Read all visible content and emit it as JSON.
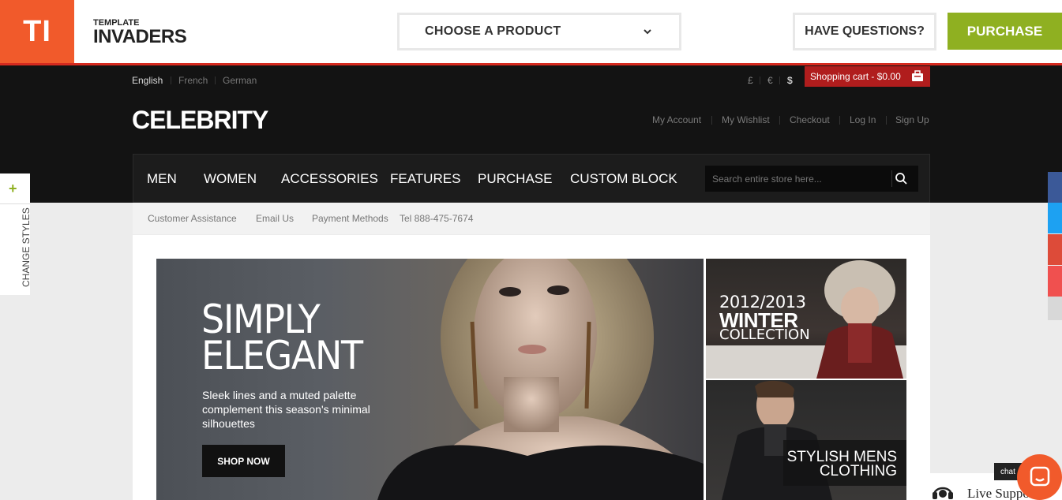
{
  "topbar": {
    "logo_text": "TI",
    "brand_small": "TEMPLATE",
    "brand_big": "INVADERS",
    "choose_product": "CHOOSE A PRODUCT",
    "have_questions": "HAVE QUESTIONS?",
    "purchase": "PURCHASE"
  },
  "store": {
    "languages": [
      "English",
      "French",
      "German"
    ],
    "currencies": [
      "£",
      "€",
      "$"
    ],
    "cart_label": "Shopping cart - $0.00",
    "logo": "CELEBRITY",
    "account_links": [
      "My Account",
      "My Wishlist",
      "Checkout",
      "Log In",
      "Sign Up"
    ],
    "nav": [
      "MEN",
      "WOMEN",
      "ACCESSORIES",
      "FEATURES",
      "PURCHASE",
      "CUSTOM BLOCK"
    ],
    "search_placeholder": "Search entire store here...",
    "sub_links": [
      "Customer Assistance",
      "Email Us",
      "Payment Methods",
      "Tel 888-475-7674"
    ]
  },
  "hero": {
    "title_line1": "SIMPLY",
    "title_line2": "ELEGANT",
    "subtitle": "Sleek lines and a muted palette complement this season's minimal silhouettes",
    "cta": "SHOP NOW"
  },
  "side_banners": {
    "winter_year": "2012/2013",
    "winter_big": "WINTER",
    "winter_coll": "COLLECTION",
    "mens_line1": "STYLISH MENS",
    "mens_line2": "CLOTHING"
  },
  "change_styles": {
    "plus": "+",
    "label": "CHANGE STYLES"
  },
  "social": {
    "icons": [
      "facebook-icon",
      "twitter-icon",
      "google-plus-icon",
      "heart-icon"
    ],
    "colors": [
      "#3b5998",
      "#1da1f2",
      "#dd4b39",
      "#f0504f"
    ]
  },
  "live_support": {
    "chat_tag": "chat",
    "text": "Live Support"
  },
  "colors": {
    "ti_orange": "#f15a2b",
    "purchase_green": "#8fb021",
    "cart_red": "#b01d1d",
    "header_dark": "#131313"
  }
}
